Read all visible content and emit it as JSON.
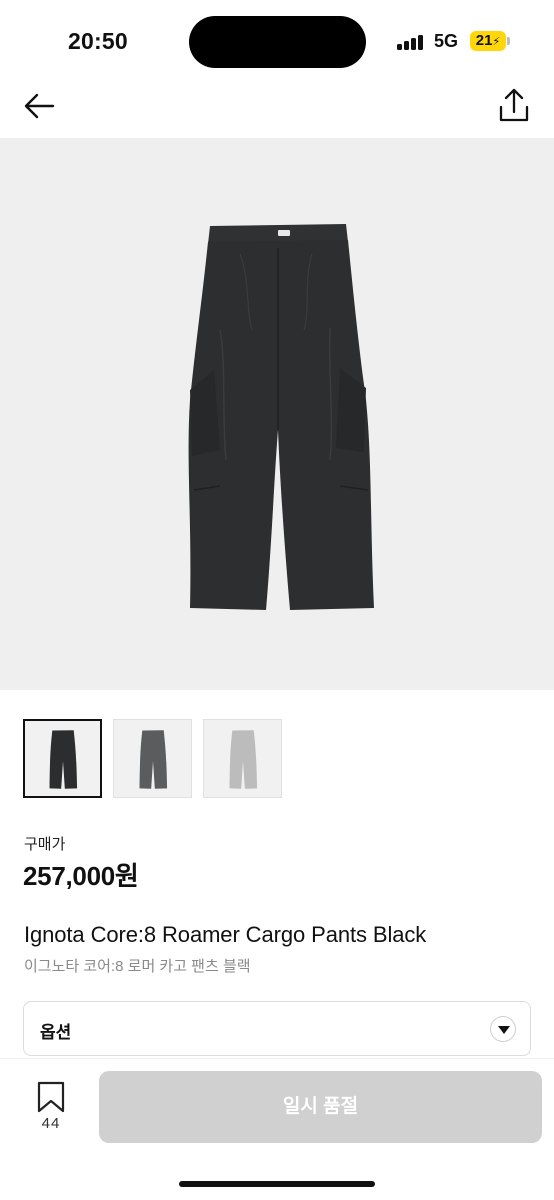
{
  "status_bar": {
    "time": "20:50",
    "network": "5G",
    "battery": "21"
  },
  "nav": {
    "back_icon": "arrow-left-icon",
    "share_icon": "share-icon"
  },
  "product": {
    "price_label": "구매가",
    "price": "257,000원",
    "title_en": "Ignota Core:8 Roamer Cargo Pants Black",
    "title_ko": "이그노타 코어:8 로머 카고 팬츠 블랙",
    "thumbnails": [
      {
        "color": "#2b2d2e",
        "selected": true
      },
      {
        "color": "#5a5c5e",
        "selected": false
      },
      {
        "color": "#bcbcbc",
        "selected": false
      }
    ]
  },
  "options": {
    "label": "옵션"
  },
  "bottom_bar": {
    "wish_count": "44",
    "action_label": "일시 품절"
  },
  "colors": {
    "hero_bg": "#efefef",
    "pants": "#2c2e2f",
    "soldout_button": "#d0d0d0",
    "battery": "#ffd60a"
  }
}
